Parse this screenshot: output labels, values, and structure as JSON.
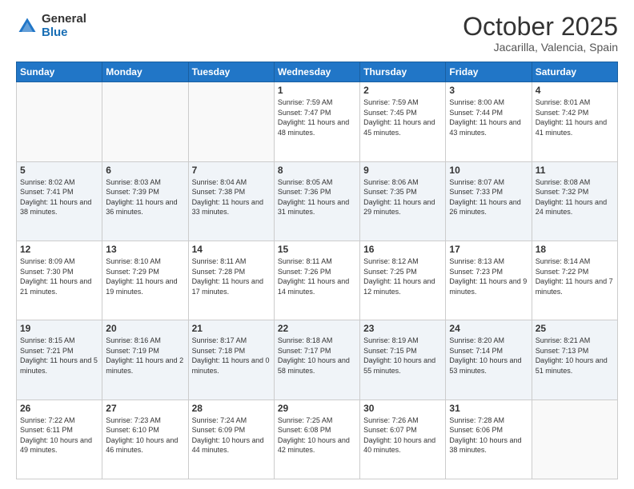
{
  "header": {
    "logo_general": "General",
    "logo_blue": "Blue",
    "month_title": "October 2025",
    "location": "Jacarilla, Valencia, Spain"
  },
  "days_of_week": [
    "Sunday",
    "Monday",
    "Tuesday",
    "Wednesday",
    "Thursday",
    "Friday",
    "Saturday"
  ],
  "weeks": [
    [
      {
        "num": "",
        "sunrise": "",
        "sunset": "",
        "daylight": ""
      },
      {
        "num": "",
        "sunrise": "",
        "sunset": "",
        "daylight": ""
      },
      {
        "num": "",
        "sunrise": "",
        "sunset": "",
        "daylight": ""
      },
      {
        "num": "1",
        "sunrise": "Sunrise: 7:59 AM",
        "sunset": "Sunset: 7:47 PM",
        "daylight": "Daylight: 11 hours and 48 minutes."
      },
      {
        "num": "2",
        "sunrise": "Sunrise: 7:59 AM",
        "sunset": "Sunset: 7:45 PM",
        "daylight": "Daylight: 11 hours and 45 minutes."
      },
      {
        "num": "3",
        "sunrise": "Sunrise: 8:00 AM",
        "sunset": "Sunset: 7:44 PM",
        "daylight": "Daylight: 11 hours and 43 minutes."
      },
      {
        "num": "4",
        "sunrise": "Sunrise: 8:01 AM",
        "sunset": "Sunset: 7:42 PM",
        "daylight": "Daylight: 11 hours and 41 minutes."
      }
    ],
    [
      {
        "num": "5",
        "sunrise": "Sunrise: 8:02 AM",
        "sunset": "Sunset: 7:41 PM",
        "daylight": "Daylight: 11 hours and 38 minutes."
      },
      {
        "num": "6",
        "sunrise": "Sunrise: 8:03 AM",
        "sunset": "Sunset: 7:39 PM",
        "daylight": "Daylight: 11 hours and 36 minutes."
      },
      {
        "num": "7",
        "sunrise": "Sunrise: 8:04 AM",
        "sunset": "Sunset: 7:38 PM",
        "daylight": "Daylight: 11 hours and 33 minutes."
      },
      {
        "num": "8",
        "sunrise": "Sunrise: 8:05 AM",
        "sunset": "Sunset: 7:36 PM",
        "daylight": "Daylight: 11 hours and 31 minutes."
      },
      {
        "num": "9",
        "sunrise": "Sunrise: 8:06 AM",
        "sunset": "Sunset: 7:35 PM",
        "daylight": "Daylight: 11 hours and 29 minutes."
      },
      {
        "num": "10",
        "sunrise": "Sunrise: 8:07 AM",
        "sunset": "Sunset: 7:33 PM",
        "daylight": "Daylight: 11 hours and 26 minutes."
      },
      {
        "num": "11",
        "sunrise": "Sunrise: 8:08 AM",
        "sunset": "Sunset: 7:32 PM",
        "daylight": "Daylight: 11 hours and 24 minutes."
      }
    ],
    [
      {
        "num": "12",
        "sunrise": "Sunrise: 8:09 AM",
        "sunset": "Sunset: 7:30 PM",
        "daylight": "Daylight: 11 hours and 21 minutes."
      },
      {
        "num": "13",
        "sunrise": "Sunrise: 8:10 AM",
        "sunset": "Sunset: 7:29 PM",
        "daylight": "Daylight: 11 hours and 19 minutes."
      },
      {
        "num": "14",
        "sunrise": "Sunrise: 8:11 AM",
        "sunset": "Sunset: 7:28 PM",
        "daylight": "Daylight: 11 hours and 17 minutes."
      },
      {
        "num": "15",
        "sunrise": "Sunrise: 8:11 AM",
        "sunset": "Sunset: 7:26 PM",
        "daylight": "Daylight: 11 hours and 14 minutes."
      },
      {
        "num": "16",
        "sunrise": "Sunrise: 8:12 AM",
        "sunset": "Sunset: 7:25 PM",
        "daylight": "Daylight: 11 hours and 12 minutes."
      },
      {
        "num": "17",
        "sunrise": "Sunrise: 8:13 AM",
        "sunset": "Sunset: 7:23 PM",
        "daylight": "Daylight: 11 hours and 9 minutes."
      },
      {
        "num": "18",
        "sunrise": "Sunrise: 8:14 AM",
        "sunset": "Sunset: 7:22 PM",
        "daylight": "Daylight: 11 hours and 7 minutes."
      }
    ],
    [
      {
        "num": "19",
        "sunrise": "Sunrise: 8:15 AM",
        "sunset": "Sunset: 7:21 PM",
        "daylight": "Daylight: 11 hours and 5 minutes."
      },
      {
        "num": "20",
        "sunrise": "Sunrise: 8:16 AM",
        "sunset": "Sunset: 7:19 PM",
        "daylight": "Daylight: 11 hours and 2 minutes."
      },
      {
        "num": "21",
        "sunrise": "Sunrise: 8:17 AM",
        "sunset": "Sunset: 7:18 PM",
        "daylight": "Daylight: 11 hours and 0 minutes."
      },
      {
        "num": "22",
        "sunrise": "Sunrise: 8:18 AM",
        "sunset": "Sunset: 7:17 PM",
        "daylight": "Daylight: 10 hours and 58 minutes."
      },
      {
        "num": "23",
        "sunrise": "Sunrise: 8:19 AM",
        "sunset": "Sunset: 7:15 PM",
        "daylight": "Daylight: 10 hours and 55 minutes."
      },
      {
        "num": "24",
        "sunrise": "Sunrise: 8:20 AM",
        "sunset": "Sunset: 7:14 PM",
        "daylight": "Daylight: 10 hours and 53 minutes."
      },
      {
        "num": "25",
        "sunrise": "Sunrise: 8:21 AM",
        "sunset": "Sunset: 7:13 PM",
        "daylight": "Daylight: 10 hours and 51 minutes."
      }
    ],
    [
      {
        "num": "26",
        "sunrise": "Sunrise: 7:22 AM",
        "sunset": "Sunset: 6:11 PM",
        "daylight": "Daylight: 10 hours and 49 minutes."
      },
      {
        "num": "27",
        "sunrise": "Sunrise: 7:23 AM",
        "sunset": "Sunset: 6:10 PM",
        "daylight": "Daylight: 10 hours and 46 minutes."
      },
      {
        "num": "28",
        "sunrise": "Sunrise: 7:24 AM",
        "sunset": "Sunset: 6:09 PM",
        "daylight": "Daylight: 10 hours and 44 minutes."
      },
      {
        "num": "29",
        "sunrise": "Sunrise: 7:25 AM",
        "sunset": "Sunset: 6:08 PM",
        "daylight": "Daylight: 10 hours and 42 minutes."
      },
      {
        "num": "30",
        "sunrise": "Sunrise: 7:26 AM",
        "sunset": "Sunset: 6:07 PM",
        "daylight": "Daylight: 10 hours and 40 minutes."
      },
      {
        "num": "31",
        "sunrise": "Sunrise: 7:28 AM",
        "sunset": "Sunset: 6:06 PM",
        "daylight": "Daylight: 10 hours and 38 minutes."
      },
      {
        "num": "",
        "sunrise": "",
        "sunset": "",
        "daylight": ""
      }
    ]
  ]
}
